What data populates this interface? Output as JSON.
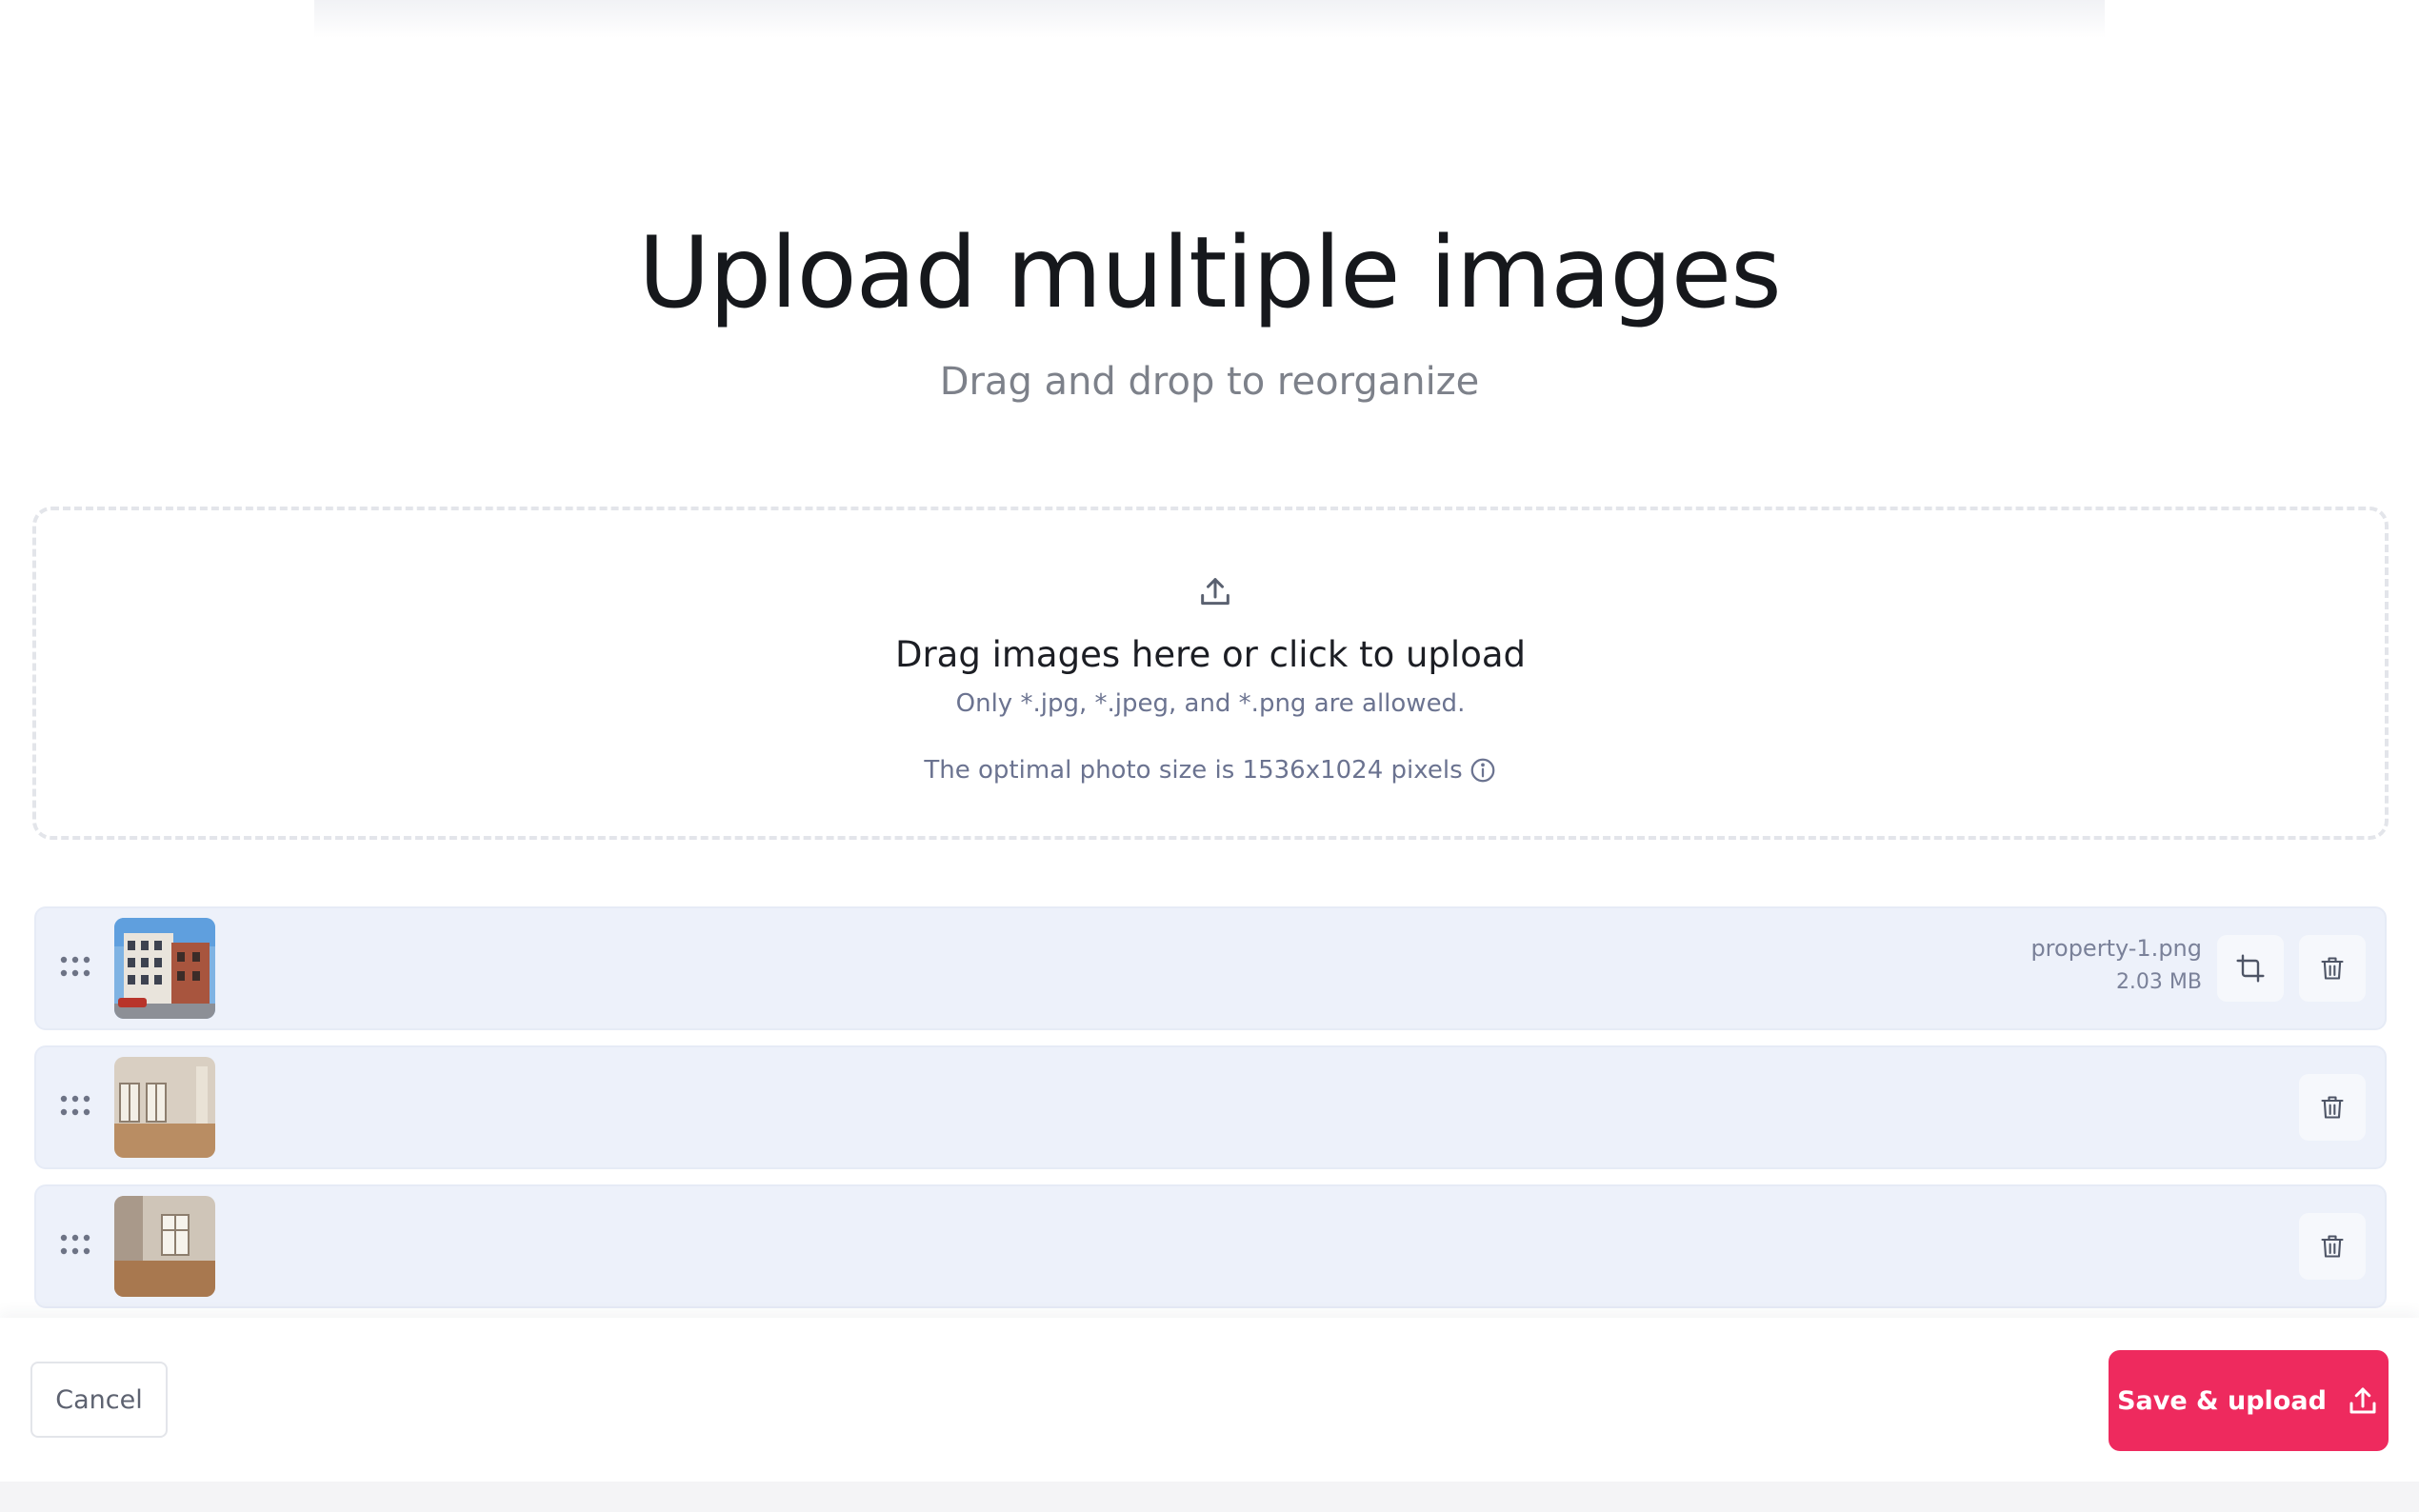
{
  "header": {
    "title": "Upload multiple images",
    "subtitle": "Drag and drop to reorganize"
  },
  "dropzone": {
    "icon": "upload-icon",
    "main_text": "Drag images here or click to upload",
    "allowed_text": "Only *.jpg, *.jpeg, and *.png are allowed.",
    "size_text": "The optimal photo size is 1536x1024 pixels",
    "info_icon": "info-icon"
  },
  "images": [
    {
      "thumb": "building-exterior",
      "file_name": "property-1.png",
      "file_size": "2.03 MB",
      "has_crop": true
    },
    {
      "thumb": "empty-room-windows",
      "file_name": "",
      "file_size": "",
      "has_crop": false
    },
    {
      "thumb": "empty-room-window",
      "file_name": "",
      "file_size": "",
      "has_crop": false
    }
  ],
  "footer": {
    "cancel_label": "Cancel",
    "save_label": "Save & upload",
    "save_icon": "upload-icon"
  },
  "colors": {
    "accent": "#ee2a5e",
    "row_background": "#edf1fa",
    "muted_text": "#6b7390"
  }
}
